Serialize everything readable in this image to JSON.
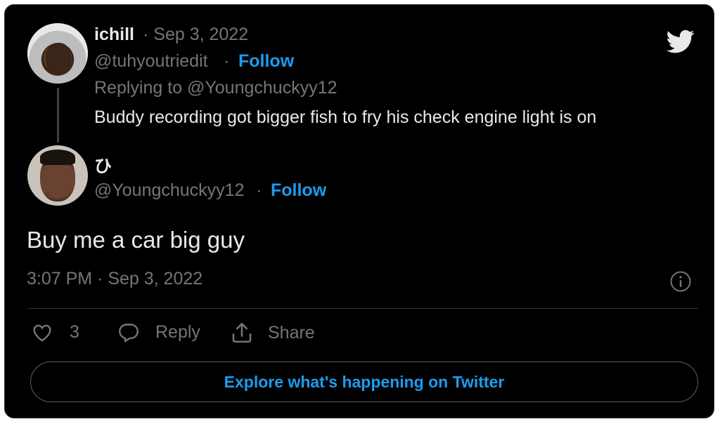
{
  "reply_tweet": {
    "display_name": "ichill",
    "date": "· Sep 3, 2022",
    "handle": "@tuhyoutriedit",
    "separator": " ·",
    "follow_label": "Follow",
    "replying_to": "Replying to @Youngchuckyy12",
    "text": "Buddy recording got bigger fish to fry his check engine light is on"
  },
  "main_tweet": {
    "display_name": "ひ",
    "handle": "@Youngchuckyy12",
    "separator": " ·",
    "follow_label": "Follow",
    "text": "Buy me a car big guy",
    "timestamp": "3:07 PM · Sep 3, 2022"
  },
  "actions": {
    "like_count": "3",
    "reply_label": "Reply",
    "share_label": "Share"
  },
  "explore_label": "Explore what's happening on Twitter",
  "icons": [
    "twitter-bird-icon",
    "info-icon",
    "heart-icon",
    "reply-icon",
    "share-icon"
  ],
  "colors": {
    "background": "#000000",
    "accent": "#1d9bf0",
    "text": "#e7e9ea",
    "muted": "#71767b"
  }
}
